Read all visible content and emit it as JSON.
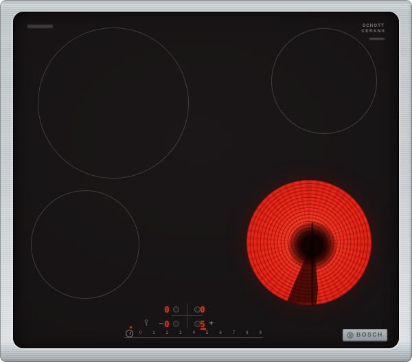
{
  "branding": {
    "glass_logo_line1": "SCHOTT",
    "glass_logo_line2": "CERAN®",
    "bosch_label": "BOSCH"
  },
  "zones": [
    {
      "id": "rear-left",
      "status": "off"
    },
    {
      "id": "rear-right",
      "status": "off"
    },
    {
      "id": "front-left",
      "status": "off"
    },
    {
      "id": "front-right",
      "status": "heating",
      "glow": "red"
    }
  ],
  "controls": {
    "displays": [
      {
        "zone": "rear-left",
        "value": "0"
      },
      {
        "zone": "rear-right",
        "value": "0"
      },
      {
        "zone": "front-left",
        "value": "0"
      },
      {
        "zone": "front-right",
        "value": "5",
        "selected": true
      }
    ],
    "minus": "−",
    "plus": "+",
    "dot": "·",
    "levels": [
      "0",
      "1",
      "2",
      "3",
      "4",
      "5",
      "6",
      "7",
      "8",
      "9"
    ]
  },
  "colors": {
    "frame_steel": "#c6cbce",
    "glass_black": "#151213",
    "digit_red": "#e0301e",
    "glow_red": "#e82318",
    "badge_text": "#4e5256"
  }
}
